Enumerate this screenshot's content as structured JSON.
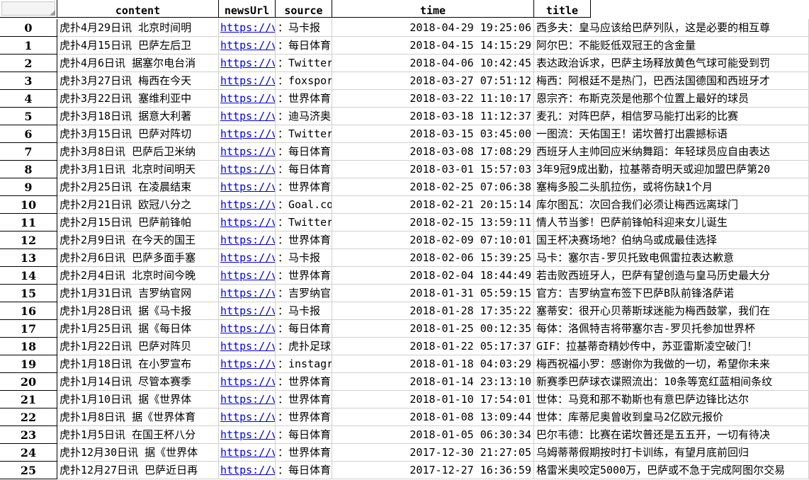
{
  "spreadsheet": {
    "columns": [
      "content",
      "newsUrl",
      "source",
      "time",
      "title"
    ],
    "rows": [
      {
        "index": "0",
        "content": "虎扑4月29日讯  北京时间明",
        "newsUrl": "https://voi",
        "source": "：马卡报",
        "time": "2018-04-29 19:25:06",
        "title": "西多夫：皇马应该给巴萨列队，这是必要的相互尊"
      },
      {
        "index": "1",
        "content": "虎扑4月15日讯  巴萨左后卫",
        "newsUrl": "https://voi",
        "source": "：每日体育",
        "time": "2018-04-15 14:15:29",
        "title": "阿尔巴：不能贬低双冠王的含金量"
      },
      {
        "index": "2",
        "content": "虎扑4月6日讯  据塞尔电台消",
        "newsUrl": "https://voi",
        "source": "：Twitter",
        "time": "2018-04-06 10:42:45",
        "title": "表达政治诉求，巴萨主场释放黄色气球可能受到罚"
      },
      {
        "index": "3",
        "content": "虎扑3月27日讯  梅西在今天",
        "newsUrl": "https://voi",
        "source": "：foxsports",
        "time": "2018-03-27 07:51:12",
        "title": "梅西：阿根廷不是热门，巴西法国德国和西班牙才"
      },
      {
        "index": "4",
        "content": "虎扑3月22日讯  塞维利亚中",
        "newsUrl": "https://voi",
        "source": "：世界体育",
        "time": "2018-03-22 11:10:17",
        "title": "恩宗齐：布斯克茨是他那个位置上最好的球员"
      },
      {
        "index": "5",
        "content": "虎扑3月18日讯  据意大利著",
        "newsUrl": "https://voi",
        "source": "：迪马济奥",
        "time": "2018-03-18 11:12:37",
        "title": "麦孔：对阵巴萨，相信罗马能打出彩的比赛"
      },
      {
        "index": "6",
        "content": "虎扑3月15日讯  巴萨对阵切",
        "newsUrl": "https://voi",
        "source": "：Twitter",
        "time": "2018-03-15 03:45:00",
        "title": "一图流：天佑国王！诺坎普打出震撼标语"
      },
      {
        "index": "7",
        "content": "虎扑3月8日讯  巴萨后卫米纳",
        "newsUrl": "https://voi",
        "source": "：每日体育",
        "time": "2018-03-08 17:08:29",
        "title": "西班牙人主帅回应米纳舞蹈：年轻球员应自由表达"
      },
      {
        "index": "8",
        "content": "虎扑3月1日讯  北京时间明天",
        "newsUrl": "https://voi",
        "source": "：每日体育",
        "time": "2018-03-01 15:57:03",
        "title": "3年9冠9成出勤，拉基蒂奇明天或迎加盟巴萨第20"
      },
      {
        "index": "9",
        "content": "虎扑2月25日讯  在凌晨结束",
        "newsUrl": "https://voi",
        "source": "：世界体育",
        "time": "2018-02-25 07:06:38",
        "title": "塞梅多股二头肌拉伤，或将伤缺1个月"
      },
      {
        "index": "10",
        "content": "虎扑2月21日讯  欧冠八分之",
        "newsUrl": "https://voi",
        "source": "：Goal.com",
        "time": "2018-02-21 20:15:14",
        "title": "库尔图瓦：次回合我们必须让梅西远离球门"
      },
      {
        "index": "11",
        "content": "虎扑2月15日讯  巴萨前锋帕",
        "newsUrl": "https://voi",
        "source": "：Twitter",
        "time": "2018-02-15 13:59:11",
        "title": "情人节当爹！巴萨前锋帕科迎来女儿诞生"
      },
      {
        "index": "12",
        "content": "虎扑2月9日讯  在今天的国王",
        "newsUrl": "https://voi",
        "source": "：世界体育",
        "time": "2018-02-09 07:10:01",
        "title": "国王杯决赛场地？伯纳乌或成最佳选择"
      },
      {
        "index": "13",
        "content": "虎扑2月6日讯  巴萨多面手塞",
        "newsUrl": "https://voi",
        "source": "：马卡报",
        "time": "2018-02-06 15:39:25",
        "title": "马卡：塞尔吉-罗贝托致电佩雷拉表达歉意"
      },
      {
        "index": "14",
        "content": "虎扑2月4日讯  北京时间今晚",
        "newsUrl": "https://voi",
        "source": "：世界体育",
        "time": "2018-02-04 18:44:49",
        "title": "若击败西班牙人，巴萨有望创造与皇马历史最大分"
      },
      {
        "index": "15",
        "content": "虎扑1月31日讯  吉罗纳官网",
        "newsUrl": "https://voi",
        "source": "：吉罗纳官网",
        "time": "2018-01-31 05:59:15",
        "title": "官方：吉罗纳宣布签下巴萨B队前锋洛萨诺"
      },
      {
        "index": "16",
        "content": "虎扑1月28日讯  据《马卡报",
        "newsUrl": "https://voi",
        "source": "：马卡报",
        "time": "2018-01-28 17:35:22",
        "title": "塞蒂安：很开心贝蒂斯球迷能为梅西鼓掌，我们在"
      },
      {
        "index": "17",
        "content": "虎扑1月25日讯  据《每日体",
        "newsUrl": "https://voi",
        "source": "：每日体育",
        "time": "2018-01-25 00:12:35",
        "title": "每体：洛佩特吉将带塞尔吉-罗贝托参加世界杯"
      },
      {
        "index": "18",
        "content": "虎扑1月22日讯  巴萨对阵贝",
        "newsUrl": "https://voi",
        "source": "：虎扑足球",
        "time": "2018-01-22 05:17:37",
        "title": "GIF：拉基蒂奇精妙传中，苏亚雷斯凌空破门！"
      },
      {
        "index": "19",
        "content": "虎扑1月18日讯  在小罗宣布",
        "newsUrl": "https://voi",
        "source": "：instagram",
        "time": "2018-01-18 04:03:29",
        "title": "梅西祝福小罗：感谢你为我做的一切，希望你未来"
      },
      {
        "index": "20",
        "content": "虎扑1月14日讯  尽管本赛季",
        "newsUrl": "https://voi",
        "source": "：世界体育",
        "time": "2018-01-14 23:13:10",
        "title": "新赛季巴萨球衣谍照流出：10条等宽红蓝相间条纹"
      },
      {
        "index": "21",
        "content": "虎扑1月10日讯  据《世界体",
        "newsUrl": "https://voi",
        "source": "：世界体育",
        "time": "2018-01-10 17:54:01",
        "title": "世体：马竞和那不勒斯也有意巴萨边锋比达尔"
      },
      {
        "index": "22",
        "content": "虎扑1月8日讯  据《世界体育",
        "newsUrl": "https://voi",
        "source": "：世界体育",
        "time": "2018-01-08 13:09:44",
        "title": "世体：库蒂尼奥曾收到皇马2亿欧元报价"
      },
      {
        "index": "23",
        "content": "虎扑1月5日讯  在国王杯八分",
        "newsUrl": "https://voi",
        "source": "：每日体育",
        "time": "2018-01-05 06:30:34",
        "title": "巴尔韦德：比赛在诺坎普还是五五开，一切有待决"
      },
      {
        "index": "24",
        "content": "虎扑12月30日讯  据《世界体",
        "newsUrl": "https://voi",
        "source": "：世界体育",
        "time": "2017-12-30 21:27:05",
        "title": "乌姆蒂蒂假期按时打卡训练，有望月底前回归"
      },
      {
        "index": "25",
        "content": "虎扑12月27日讯  巴萨近日再",
        "newsUrl": "https://voi",
        "source": "：每日体育",
        "time": "2017-12-27 16:36:59",
        "title": "格雷米奥咬定5000万，巴萨或不急于完成阿图尔交易"
      }
    ]
  }
}
